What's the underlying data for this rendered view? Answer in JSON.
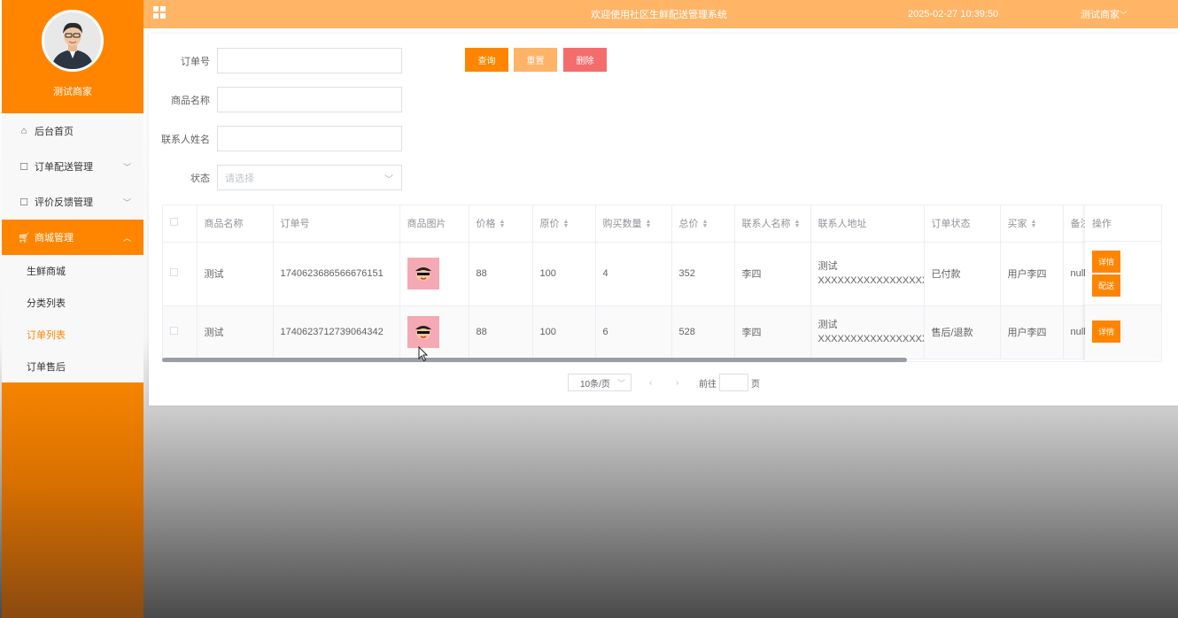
{
  "colors": {
    "brand": "#ff8500",
    "topbar": "#ffb466",
    "delete": "#f56c6c",
    "reset": "#ffb366"
  },
  "sidebar": {
    "username": "测试商家",
    "menu": [
      {
        "label": "后台首页",
        "icon": "home-icon"
      },
      {
        "label": "订单配送管理",
        "icon": "edit-icon"
      },
      {
        "label": "评价反馈管理",
        "icon": "edit-icon"
      },
      {
        "label": "商城管理",
        "icon": "cart-icon"
      }
    ],
    "submenu": [
      "生鲜商城",
      "分类列表",
      "订单列表",
      "订单售后"
    ]
  },
  "topbar": {
    "title": "欢迎使用社区生鲜配送管理系统",
    "datetime": "2025-02-27 10:39:50",
    "user": "测试商家"
  },
  "search": {
    "order_no_label": "订单号",
    "product_name_label": "商品名称",
    "contact_name_label": "联系人姓名",
    "status_label": "状态",
    "status_placeholder": "请选择",
    "query_button": "查询",
    "reset_button": "重置",
    "delete_button": "删除"
  },
  "table": {
    "headers": [
      "商品名称",
      "订单号",
      "商品图片",
      "价格",
      "原价",
      "购买数量",
      "总价",
      "联系人名称",
      "联系人地址",
      "订单状态",
      "买家",
      "备注",
      "操作"
    ],
    "rows": [
      {
        "product": "测试",
        "order_no": "1740623686566676151",
        "price": "88",
        "original_price": "100",
        "qty": "4",
        "total": "352",
        "contact": "李四",
        "address": "测试XXXXXXXXXXXXXXXXXXXXXXXXXX",
        "status": "已付款",
        "buyer": "用户李四",
        "remark": "null",
        "actions": [
          "详情",
          "配送"
        ]
      },
      {
        "product": "测试",
        "order_no": "1740623712739064342",
        "price": "88",
        "original_price": "100",
        "qty": "6",
        "total": "528",
        "contact": "李四",
        "address": "测试XXXXXXXXXXXXXXXXXXXXXXXXXX",
        "status": "售后/退款",
        "buyer": "用户李四",
        "remark": "null",
        "actions": [
          "详情"
        ]
      }
    ]
  },
  "pagination": {
    "page_size": "10条/页",
    "goto_label": "前往",
    "page_suffix": "页"
  }
}
